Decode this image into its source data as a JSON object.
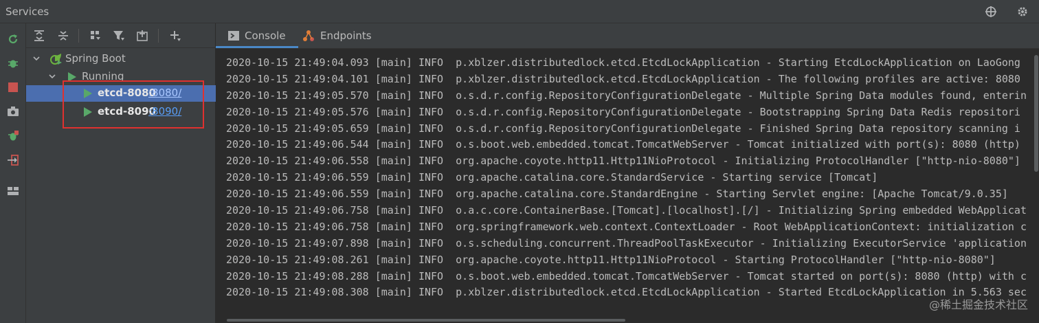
{
  "window": {
    "title": "Services"
  },
  "titlebar_icons": [
    "crosshair-icon",
    "gear-icon"
  ],
  "left_toolbar": [
    "rerun-icon",
    "debug-icon",
    "stop-icon",
    "camera-icon",
    "coverage-icon",
    "exit-icon",
    "layout-icon"
  ],
  "tree_toolbar": [
    "expand-all-icon",
    "collapse-all-icon",
    "group-by-icon",
    "filter-icon",
    "new-service-icon",
    "add-icon"
  ],
  "tree": {
    "root": {
      "label": "Spring Boot"
    },
    "group": {
      "label": "Running"
    },
    "items": [
      {
        "name": "etcd-8080",
        "port": ":8080/"
      },
      {
        "name": "etcd-8090",
        "port": ":8090/"
      }
    ]
  },
  "tabs": [
    {
      "label": "Console",
      "icon": "console-icon",
      "active": true
    },
    {
      "label": "Endpoints",
      "icon": "endpoints-icon",
      "active": false
    }
  ],
  "log": [
    "2020-10-15 21:49:04.093 [main] INFO  p.xblzer.distributedlock.etcd.EtcdLockApplication - Starting EtcdLockApplication on LaoGong",
    "2020-10-15 21:49:04.101 [main] INFO  p.xblzer.distributedlock.etcd.EtcdLockApplication - The following profiles are active: 8080",
    "2020-10-15 21:49:05.570 [main] INFO  o.s.d.r.config.RepositoryConfigurationDelegate - Multiple Spring Data modules found, enterin",
    "2020-10-15 21:49:05.576 [main] INFO  o.s.d.r.config.RepositoryConfigurationDelegate - Bootstrapping Spring Data Redis repositori",
    "2020-10-15 21:49:05.659 [main] INFO  o.s.d.r.config.RepositoryConfigurationDelegate - Finished Spring Data repository scanning i",
    "2020-10-15 21:49:06.544 [main] INFO  o.s.boot.web.embedded.tomcat.TomcatWebServer - Tomcat initialized with port(s): 8080 (http)",
    "2020-10-15 21:49:06.558 [main] INFO  org.apache.coyote.http11.Http11NioProtocol - Initializing ProtocolHandler [\"http-nio-8080\"]",
    "2020-10-15 21:49:06.559 [main] INFO  org.apache.catalina.core.StandardService - Starting service [Tomcat]",
    "2020-10-15 21:49:06.559 [main] INFO  org.apache.catalina.core.StandardEngine - Starting Servlet engine: [Apache Tomcat/9.0.35]",
    "2020-10-15 21:49:06.758 [main] INFO  o.a.c.core.ContainerBase.[Tomcat].[localhost].[/] - Initializing Spring embedded WebApplicat",
    "2020-10-15 21:49:06.758 [main] INFO  org.springframework.web.context.ContextLoader - Root WebApplicationContext: initialization c",
    "2020-10-15 21:49:07.898 [main] INFO  o.s.scheduling.concurrent.ThreadPoolTaskExecutor - Initializing ExecutorService 'application",
    "2020-10-15 21:49:08.261 [main] INFO  org.apache.coyote.http11.Http11NioProtocol - Starting ProtocolHandler [\"http-nio-8080\"]",
    "2020-10-15 21:49:08.288 [main] INFO  o.s.boot.web.embedded.tomcat.TomcatWebServer - Tomcat started on port(s): 8080 (http) with c",
    "2020-10-15 21:49:08.308 [main] INFO  p.xblzer.distributedlock.etcd.EtcdLockApplication - Started EtcdLockApplication in 5.563 sec"
  ],
  "watermark": "@稀土掘金技术社区",
  "colors": {
    "accent": "#4b6eaf",
    "run_green": "#59a869",
    "stop_red": "#c75450",
    "highlight_box": "#e0312f"
  }
}
